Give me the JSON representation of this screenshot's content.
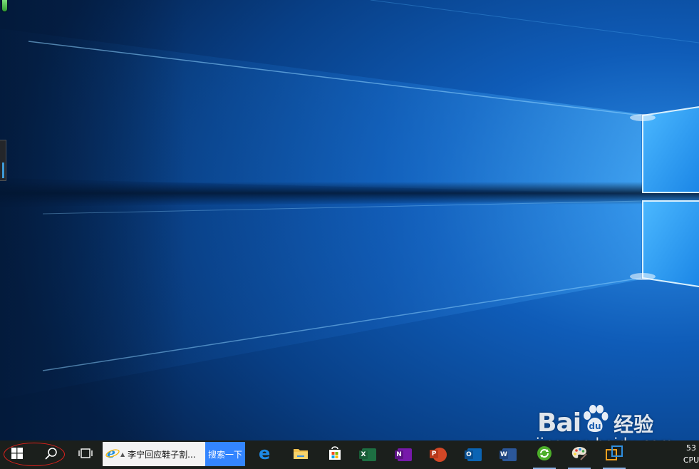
{
  "wallpaper": {
    "name": "windows-10-hero",
    "colors": {
      "base": "#062a5a",
      "glow": "#1a7fe0",
      "light": "#63c2ff"
    }
  },
  "taskbar": {
    "background": "#1b1f1c",
    "start_icon": "windows-logo-icon",
    "search_icon": "search-icon",
    "task_view_icon": "task-view-icon",
    "ie_search": {
      "icon": "ie-icon",
      "query": "李宁回应鞋子割...",
      "submit_label": "搜索一下"
    },
    "pinned_apps": [
      {
        "name": "edge",
        "icon": "edge-icon",
        "running": false
      },
      {
        "name": "file-explorer",
        "icon": "folder-icon",
        "running": false
      },
      {
        "name": "store",
        "icon": "store-icon",
        "running": false
      },
      {
        "name": "excel",
        "icon": "excel-icon",
        "badge": "X",
        "color": "#1d6f42",
        "running": false
      },
      {
        "name": "onenote",
        "icon": "onenote-icon",
        "badge": "N",
        "color": "#7719aa",
        "running": false
      },
      {
        "name": "powerpoint",
        "icon": "powerpoint-icon",
        "badge": "P",
        "color": "#d24726",
        "running": false
      },
      {
        "name": "outlook",
        "icon": "outlook-icon",
        "badge": "O",
        "color": "#0a64b4",
        "running": false
      },
      {
        "name": "word",
        "icon": "word-icon",
        "badge": "W",
        "color": "#2b579a",
        "running": false
      },
      {
        "name": "sync-app",
        "icon": "green-sync-icon",
        "running": true
      },
      {
        "name": "paint-app",
        "icon": "palette-icon",
        "running": true
      },
      {
        "name": "remote-app",
        "icon": "remote-desktop-icon",
        "running": true
      }
    ],
    "tray": {
      "value": "53",
      "label": "CPU"
    },
    "start_highlight_color": "#e0211d"
  },
  "watermark": {
    "brand_left": "Bai",
    "brand_right": "du",
    "brand_suffix": "经验",
    "domain": "jingyan.baidu.com"
  }
}
